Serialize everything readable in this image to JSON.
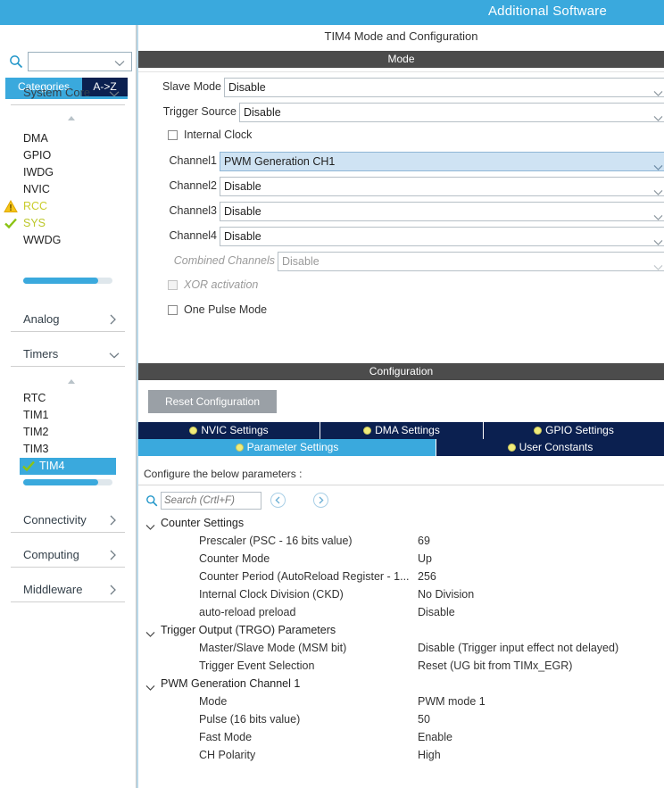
{
  "topbar": {
    "title": "Additional Software"
  },
  "sidebar": {
    "search": {
      "value": "",
      "placeholder": ""
    },
    "tabs": [
      {
        "label": "Categories",
        "active": true
      },
      {
        "label": "A->Z",
        "active": false
      }
    ],
    "groups": [
      {
        "label": "System Core",
        "expanded": true,
        "items": [
          {
            "label": "DMA",
            "icon": "none"
          },
          {
            "label": "GPIO",
            "icon": "none"
          },
          {
            "label": "IWDG",
            "icon": "none"
          },
          {
            "label": "NVIC",
            "icon": "none"
          },
          {
            "label": "RCC",
            "icon": "warning-icon"
          },
          {
            "label": "SYS",
            "icon": "check-icon"
          },
          {
            "label": "WWDG",
            "icon": "none"
          }
        ]
      },
      {
        "label": "Analog",
        "expanded": false,
        "items": []
      },
      {
        "label": "Timers",
        "expanded": true,
        "items": [
          {
            "label": "RTC",
            "icon": "none"
          },
          {
            "label": "TIM1",
            "icon": "none"
          },
          {
            "label": "TIM2",
            "icon": "none"
          },
          {
            "label": "TIM3",
            "icon": "none"
          },
          {
            "label": "TIM4",
            "icon": "check-icon",
            "selected": true
          }
        ]
      },
      {
        "label": "Connectivity",
        "expanded": false,
        "items": []
      },
      {
        "label": "Computing",
        "expanded": false,
        "items": []
      },
      {
        "label": "Middleware",
        "expanded": false,
        "items": []
      }
    ]
  },
  "main": {
    "header": "TIM4 Mode and Configuration",
    "mode": {
      "section_title": "Mode",
      "fields": [
        {
          "kind": "combo",
          "label": "Slave Mode",
          "value": "Disable",
          "highlight": false,
          "disabled": false
        },
        {
          "kind": "combo",
          "label": "Trigger Source",
          "value": "Disable",
          "highlight": false,
          "disabled": false
        },
        {
          "kind": "checkbox",
          "label": "Internal Clock",
          "checked": false,
          "disabled": false
        },
        {
          "kind": "combo",
          "label": "Channel1",
          "value": "PWM Generation CH1",
          "highlight": true,
          "disabled": false
        },
        {
          "kind": "combo",
          "label": "Channel2",
          "value": "Disable",
          "highlight": false,
          "disabled": false
        },
        {
          "kind": "combo",
          "label": "Channel3",
          "value": "Disable",
          "highlight": false,
          "disabled": false
        },
        {
          "kind": "combo",
          "label": "Channel4",
          "value": "Disable",
          "highlight": false,
          "disabled": false
        },
        {
          "kind": "combo",
          "label": "Combined Channels",
          "value": "Disable",
          "highlight": false,
          "disabled": true
        },
        {
          "kind": "checkbox",
          "label": "XOR activation",
          "checked": false,
          "disabled": true
        },
        {
          "kind": "checkbox",
          "label": "One Pulse Mode",
          "checked": false,
          "disabled": false
        }
      ]
    },
    "configuration": {
      "section_title": "Configuration",
      "reset_label": "Reset Configuration",
      "tabs_row1": [
        {
          "label": "NVIC Settings",
          "active": false
        },
        {
          "label": "DMA Settings",
          "active": false
        },
        {
          "label": "GPIO Settings",
          "active": false
        }
      ],
      "tabs_row2": [
        {
          "label": "Parameter Settings",
          "active": true
        },
        {
          "label": "User Constants",
          "active": false
        }
      ],
      "note": "Configure the below parameters :",
      "search": {
        "value": "",
        "placeholder": "Search (Crtl+F)"
      },
      "nav_back": "back-icon",
      "nav_forward": "forward-icon",
      "param_groups": [
        {
          "label": "Counter Settings",
          "expanded": true,
          "rows": [
            {
              "name": "Prescaler (PSC - 16 bits value)",
              "value": "69"
            },
            {
              "name": "Counter Mode",
              "value": "Up"
            },
            {
              "name": "Counter Period (AutoReload Register - 1...",
              "value": "256"
            },
            {
              "name": "Internal Clock Division (CKD)",
              "value": "No Division"
            },
            {
              "name": "auto-reload preload",
              "value": "Disable"
            }
          ]
        },
        {
          "label": "Trigger Output (TRGO) Parameters",
          "expanded": true,
          "rows": [
            {
              "name": "Master/Slave Mode (MSM bit)",
              "value": "Disable (Trigger input effect not delayed)"
            },
            {
              "name": "Trigger Event Selection",
              "value": "Reset (UG bit from TIMx_EGR)"
            }
          ]
        },
        {
          "label": "PWM Generation Channel 1",
          "expanded": true,
          "rows": [
            {
              "name": "Mode",
              "value": "PWM mode 1"
            },
            {
              "name": "Pulse (16 bits value)",
              "value": "50"
            },
            {
              "name": "Fast Mode",
              "value": "Enable"
            },
            {
              "name": "CH Polarity",
              "value": "High"
            }
          ]
        }
      ]
    }
  },
  "colors": {
    "accent": "#3aa9dd",
    "navy": "#0b2050",
    "section_bar": "#4c4c4c",
    "warning": "#e8b320",
    "ok": "#7dc00a",
    "highlight": "#cfe3f3"
  }
}
